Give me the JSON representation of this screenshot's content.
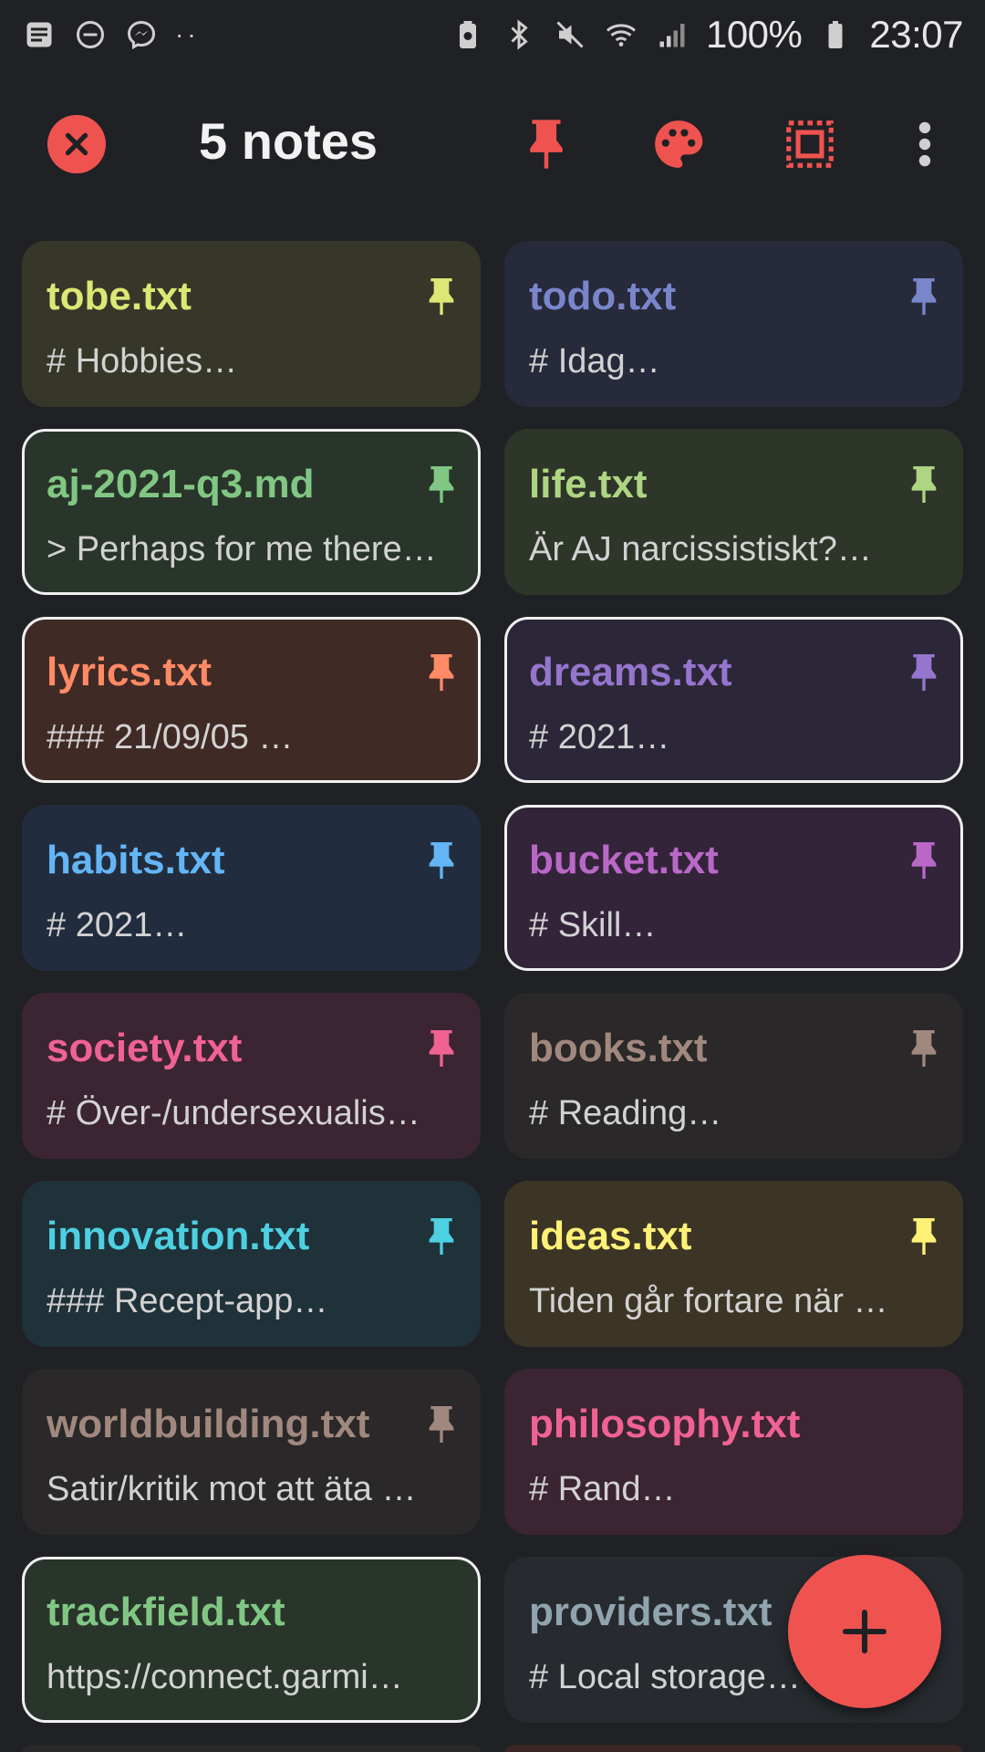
{
  "status_bar": {
    "left_icons": [
      "notes-icon",
      "do-not-disturb-icon",
      "messenger-icon"
    ],
    "more_dots": "··",
    "right_icons": [
      "battery-saver-icon",
      "bluetooth-icon",
      "mute-icon",
      "wifi-icon",
      "signal-icon"
    ],
    "battery_percent": "100%",
    "time": "23:07"
  },
  "toolbar": {
    "title": "5 notes",
    "accent_color": "#ef5350",
    "actions": [
      "pin-icon",
      "palette-icon",
      "select-all-icon",
      "more-vert-icon"
    ]
  },
  "notes": [
    {
      "title": "tobe.txt",
      "preview": "# Hobbies…",
      "color": "#dce775",
      "bg": "#373729",
      "pinned": true,
      "selected": false
    },
    {
      "title": "todo.txt",
      "preview": "# Idag…",
      "color": "#7986cb",
      "bg": "#262a3a",
      "pinned": true,
      "selected": false
    },
    {
      "title": "aj-2021-q3.md",
      "preview": "> Perhaps for me there…",
      "color": "#81c784",
      "bg": "#29352a",
      "pinned": true,
      "selected": true
    },
    {
      "title": "life.txt",
      "preview": "Är AJ narcissistiskt?…",
      "color": "#aed581",
      "bg": "#2e3529",
      "pinned": true,
      "selected": false
    },
    {
      "title": "lyrics.txt",
      "preview": "### 21/09/05 …",
      "color": "#ff8a65",
      "bg": "#402a25",
      "pinned": true,
      "selected": true
    },
    {
      "title": "dreams.txt",
      "preview": "# 2021…",
      "color": "#9575cd",
      "bg": "#2c2738",
      "pinned": true,
      "selected": true
    },
    {
      "title": "habits.txt",
      "preview": "# 2021…",
      "color": "#64b5f6",
      "bg": "#212d3e",
      "pinned": true,
      "selected": false
    },
    {
      "title": "bucket.txt",
      "preview": "# Skill…",
      "color": "#ba68c8",
      "bg": "#33243a",
      "pinned": true,
      "selected": true
    },
    {
      "title": "society.txt",
      "preview": "# Över-/undersexualis…",
      "color": "#f06292",
      "bg": "#3b2532",
      "pinned": true,
      "selected": false
    },
    {
      "title": "books.txt",
      "preview": "# Reading…",
      "color": "#a1887f",
      "bg": "#2a2828",
      "pinned": true,
      "selected": false
    },
    {
      "title": "innovation.txt",
      "preview": "### Recept-app…",
      "color": "#4dd0e1",
      "bg": "#1f3139",
      "pinned": true,
      "selected": false
    },
    {
      "title": "ideas.txt",
      "preview": "Tiden går fortare när …",
      "color": "#fff176",
      "bg": "#3c3526",
      "pinned": true,
      "selected": false
    },
    {
      "title": "worldbuilding.txt",
      "preview": "Satir/kritik mot att äta …",
      "color": "#a1887f",
      "bg": "#2a2828",
      "pinned": true,
      "selected": false
    },
    {
      "title": "philosophy.txt",
      "preview": "# Rand…",
      "color": "#f06292",
      "bg": "#3b2532",
      "pinned": false,
      "selected": false
    },
    {
      "title": "trackfield.txt",
      "preview": "https://connect.garmi…",
      "color": "#81c784",
      "bg": "#29352a",
      "pinned": false,
      "selected": true
    },
    {
      "title": "providers.txt",
      "preview": "# Local storage…",
      "color": "#90a4ae",
      "bg": "#272b2f",
      "pinned": false,
      "selected": false
    }
  ],
  "fab": {
    "icon": "plus-icon",
    "color": "#ef5350"
  }
}
